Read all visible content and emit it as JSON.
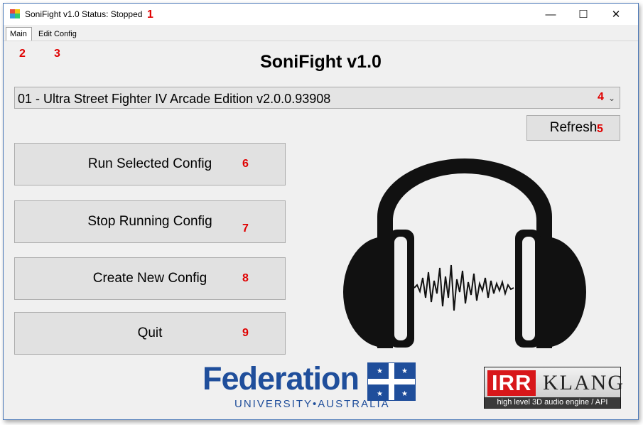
{
  "window": {
    "title": "SoniFight v1.0 Status: Stopped",
    "controls": {
      "minimize": "—",
      "maximize": "☐",
      "close": "✕"
    }
  },
  "tabs": [
    {
      "label": "Main",
      "selected": true
    },
    {
      "label": "Edit Config",
      "selected": false
    }
  ],
  "main": {
    "title": "SoniFight v1.0",
    "config_select": {
      "value": "01 - Ultra Street Fighter IV Arcade Edition v2.0.0.93908",
      "arrow": "⌄"
    },
    "refresh_label": "Refresh",
    "buttons": {
      "run": "Run Selected Config",
      "stop": "Stop Running Config",
      "create": "Create New Config",
      "quit": "Quit"
    }
  },
  "logos": {
    "federation": {
      "word": "Federation",
      "sub": "UNIVERSITY•AUSTRALIA"
    },
    "irrklang": {
      "left": "IRR",
      "right": "KLANG",
      "tagline": "high level 3D audio engine / API"
    }
  },
  "annotations": [
    "1",
    "2",
    "3",
    "4",
    "5",
    "6",
    "7",
    "8",
    "9"
  ],
  "colors": {
    "annotation": "#e00000",
    "federation_blue": "#1f4e9b",
    "irrklang_red": "#d8171a",
    "window_border": "#4a78b8"
  }
}
